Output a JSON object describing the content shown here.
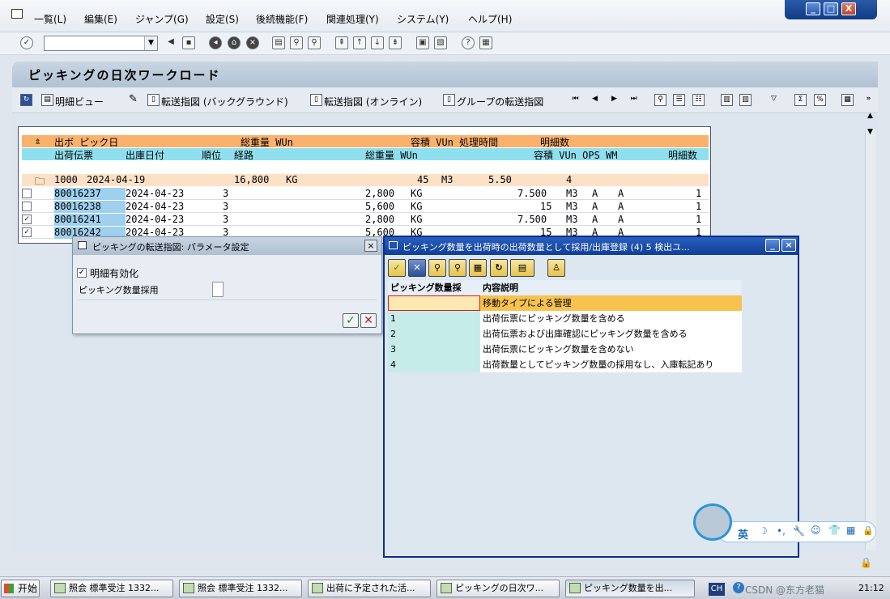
{
  "menubar": {
    "items": [
      "一覧(L)",
      "編集(E)",
      "ジャンプ(G)",
      "設定(S)",
      "後続機能(F)",
      "関連処理(Y)",
      "システム(Y)",
      "ヘルプ(H)"
    ],
    "window_buttons": [
      "_",
      "□",
      "X"
    ]
  },
  "screen": {
    "title": "ピッキングの日次ワークロード",
    "toolbar": {
      "detail_view": "明細ビュー",
      "transfer_background": "転送指図 (バックグラウンド)",
      "transfer_online": "転送指図 (オンライン)",
      "group_transfer": "グループの転送指図"
    }
  },
  "list": {
    "header1": {
      "c1": "出ボ ピック日",
      "c2": "総重量 WUn",
      "c3": "容積 VUn 処理時間",
      "c4": "明細数"
    },
    "header2": {
      "c1": "出荷伝票",
      "c2": "出庫日付",
      "c3": "順位",
      "c4": "経路",
      "c5": "総重量 WUn",
      "c6": "容積 VUn OPS WM",
      "c7": "明細数"
    },
    "group": {
      "id": "1000",
      "date": "2024-04-19",
      "weight": "16,800",
      "wunit": "KG",
      "volume": "45",
      "vunit": "M3",
      "time": "5.50",
      "count": "4"
    },
    "rows": [
      {
        "checked": "",
        "doc": "80016237",
        "date": "2024-04-23",
        "prio": "3",
        "weight": "2,800",
        "wunit": "KG",
        "volume": "7.500",
        "vunit": "M3",
        "ops": "A",
        "wm": "A",
        "count": "1"
      },
      {
        "checked": "",
        "doc": "80016238",
        "date": "2024-04-23",
        "prio": "3",
        "weight": "5,600",
        "wunit": "KG",
        "volume": "15",
        "vunit": "M3",
        "ops": "A",
        "wm": "A",
        "count": "1"
      },
      {
        "checked": "✓",
        "doc": "80016241",
        "date": "2024-04-23",
        "prio": "3",
        "weight": "2,800",
        "wunit": "KG",
        "volume": "7.500",
        "vunit": "M3",
        "ops": "A",
        "wm": "A",
        "count": "1"
      },
      {
        "checked": "✓",
        "doc": "80016242",
        "date": "2024-04-23",
        "prio": "3",
        "weight": "5,600",
        "wunit": "KG",
        "volume": "15",
        "vunit": "M3",
        "ops": "A",
        "wm": "A",
        "count": "1"
      }
    ]
  },
  "dialog1": {
    "title": "ピッキングの転送指図: パラメータ設定",
    "detail_active": "明細有効化",
    "picking_qty_label": "ピッキング数量採用",
    "picking_qty_value": "",
    "detail_checked": "✓"
  },
  "dialog2": {
    "title": "ピッキング数量を出荷時の出荷数量として採用/出庫登録 (4)   5 検出ユ...",
    "col_key": "ピッキング数量採",
    "col_text": "内容説明",
    "rows": [
      {
        "key": "",
        "text": "移動タイプによる管理"
      },
      {
        "key": "1",
        "text": "出荷伝票にピッキング数量を含める"
      },
      {
        "key": "2",
        "text": "出荷伝票および出庫確認にピッキング数量を含める"
      },
      {
        "key": "3",
        "text": "出荷伝票にピッキング数量を含めない"
      },
      {
        "key": "4",
        "text": "出荷数量としてピッキング数量の採用なし、入庫転記あり"
      }
    ]
  },
  "taskbar": {
    "start": "开始",
    "tasks": [
      "照会 標準受注 1332...",
      "照会 標準受注 1332...",
      "出荷に予定された活...",
      "ピッキングの日次ワ...",
      "ピッキング数量を出..."
    ],
    "lang": "CH",
    "clock": "21:12",
    "watermark": "CSDN @东方老猫"
  },
  "ime": {
    "mode": "英"
  }
}
